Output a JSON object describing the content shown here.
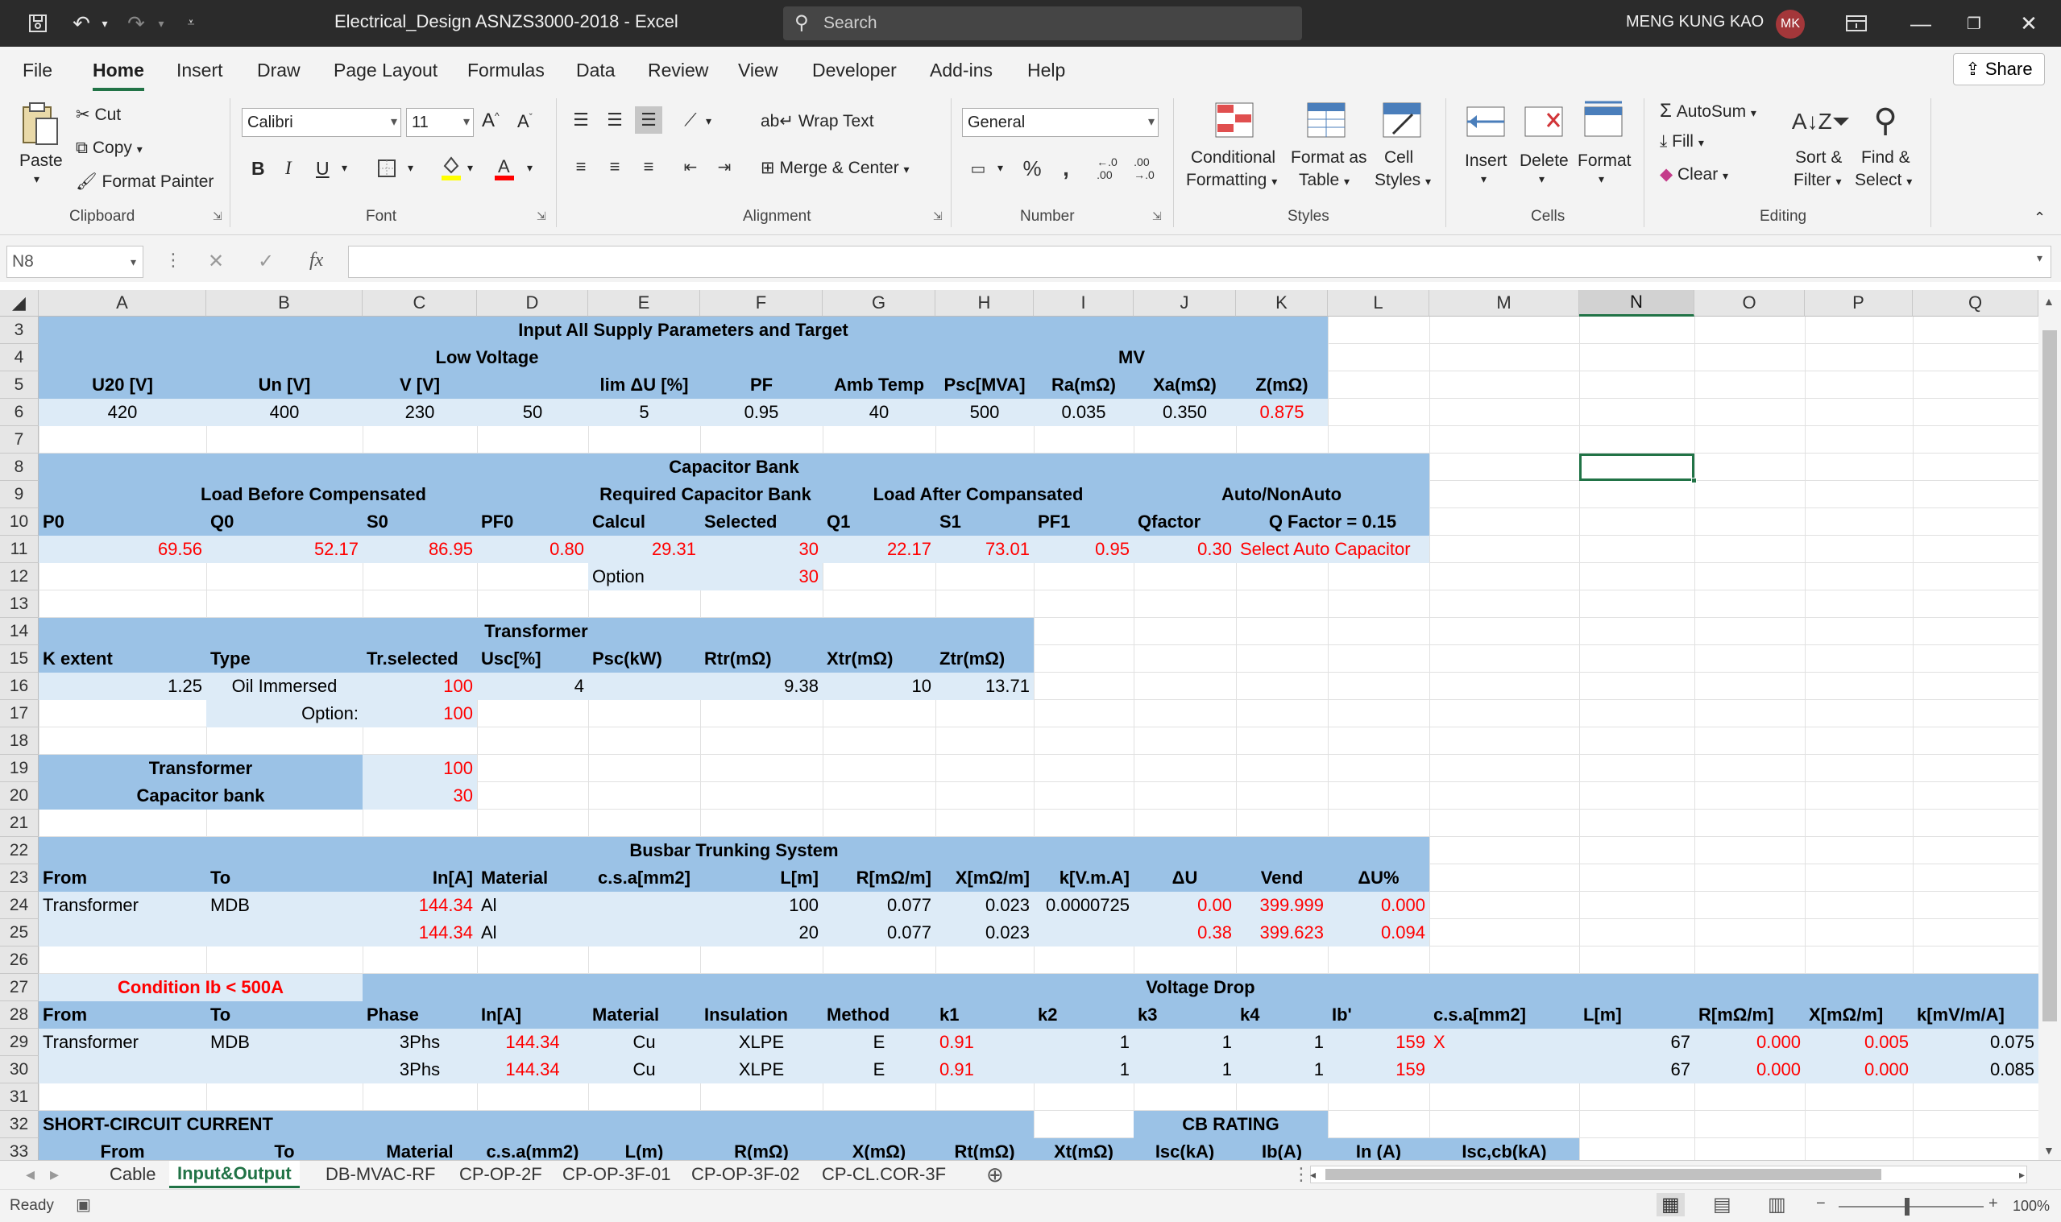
{
  "app": {
    "title": "Electrical_Design ASNZS3000-2018  -  Excel",
    "search_placeholder": "Search",
    "user_name": "MENG KUNG KAO",
    "user_initials": "MK"
  },
  "menu": [
    "File",
    "Home",
    "Insert",
    "Draw",
    "Page Layout",
    "Formulas",
    "Data",
    "Review",
    "View",
    "Developer",
    "Add-ins",
    "Help"
  ],
  "share": "Share",
  "ribbon": {
    "clipboard": {
      "paste": "Paste",
      "cut": "Cut",
      "copy": "Copy",
      "format_painter": "Format Painter",
      "group": "Clipboard"
    },
    "font": {
      "name": "Calibri",
      "size": "11",
      "bold": "B",
      "italic": "I",
      "underline": "U",
      "group": "Font"
    },
    "alignment": {
      "wrap": "Wrap Text",
      "merge": "Merge & Center",
      "group": "Alignment"
    },
    "number": {
      "format": "General",
      "group": "Number"
    },
    "styles": {
      "cond1": "Conditional",
      "cond2": "Formatting",
      "fat1": "Format as",
      "fat2": "Table",
      "cs1": "Cell",
      "cs2": "Styles",
      "group": "Styles"
    },
    "cells": {
      "insert": "Insert",
      "delete": "Delete",
      "format": "Format",
      "group": "Cells"
    },
    "editing": {
      "autosum": "AutoSum",
      "fill": "Fill",
      "clear": "Clear",
      "sort1": "Sort &",
      "sort2": "Filter",
      "find1": "Find &",
      "find2": "Select",
      "group": "Editing"
    }
  },
  "namebox": "N8",
  "fx": "fx",
  "columns": [
    "A",
    "B",
    "C",
    "D",
    "E",
    "F",
    "G",
    "H",
    "I",
    "J",
    "K",
    "L",
    "M",
    "N",
    "O",
    "P",
    "Q"
  ],
  "rows": [
    "3",
    "4",
    "5",
    "6",
    "7",
    "8",
    "9",
    "10",
    "11",
    "12",
    "13",
    "14",
    "15",
    "16",
    "17",
    "18",
    "19",
    "20",
    "21",
    "22",
    "23",
    "24",
    "25",
    "26",
    "27",
    "28",
    "29",
    "30",
    "31",
    "32",
    "33"
  ],
  "cells": {
    "r3": "Input All Supply Parameters and Target",
    "r4lv": "Low Voltage",
    "r4mv": "MV",
    "r5": [
      "U20 [V]",
      "Un [V]",
      "V [V]",
      "",
      "lim ΔU [%]",
      "PF",
      "Amb Temp",
      "Psc[MVA]",
      "Ra(mΩ)",
      "Xa(mΩ)",
      "Z(mΩ)"
    ],
    "r6": [
      "420",
      "400",
      "230",
      "50",
      "5",
      "0.95",
      "40",
      "500",
      "0.035",
      "0.350",
      "0.875"
    ],
    "r8": "Capacitor Bank",
    "r9": [
      "Load Before Compensated",
      "Required Capacitor Bank",
      "Load After Compansated",
      "Auto/NonAuto"
    ],
    "r10": [
      "P0",
      "Q0",
      "S0",
      "PF0",
      "Calcul",
      "Selected",
      "Q1",
      "S1",
      "PF1",
      "Qfactor",
      "Q Factor = 0.15"
    ],
    "r11": [
      "69.56",
      "52.17",
      "86.95",
      "0.80",
      "29.31",
      "30",
      "22.17",
      "73.01",
      "0.95",
      "0.30",
      "Select Auto Capacitor"
    ],
    "r12": [
      "Option",
      "30"
    ],
    "r14": "Transformer",
    "r15": [
      "K extent",
      "Type",
      "Tr.selected",
      "Usc[%]",
      "Psc(kW)",
      "Rtr(mΩ)",
      "Xtr(mΩ)",
      "Ztr(mΩ)"
    ],
    "r16": [
      "1.25",
      "Oil Immersed",
      "100",
      "4",
      "9.38",
      "10",
      "13.71"
    ],
    "r17": [
      "Option:",
      "100"
    ],
    "r19": [
      "Transformer",
      "100"
    ],
    "r20": [
      "Capacitor bank",
      "30"
    ],
    "r22": "Busbar Trunking System",
    "r23": [
      "From",
      "To",
      "In[A]",
      "Material",
      "c.s.a[mm2]",
      "L[m]",
      "R[mΩ/m]",
      "X[mΩ/m]",
      "k[V.m.A]",
      "ΔU",
      "Vend",
      "ΔU%"
    ],
    "r24": [
      "Transformer",
      "MDB",
      "144.34",
      "Al",
      "100",
      "0.077",
      "0.023",
      "0.0000725",
      "0.00",
      "399.999",
      "0.000"
    ],
    "r25": [
      "144.34",
      "Al",
      "20",
      "0.077",
      "0.023",
      "0.38",
      "399.623",
      "0.094"
    ],
    "r27": [
      "Condition Ib < 500A",
      "Voltage Drop"
    ],
    "r28": [
      "From",
      "To",
      "Phase",
      "In[A]",
      "Material",
      "Insulation",
      "Method",
      "k1",
      "k2",
      "k3",
      "k4",
      "Ib'",
      "c.s.a[mm2]",
      "L[m]",
      "R[mΩ/m]",
      "X[mΩ/m]",
      "k[mV/m/A]"
    ],
    "r29": [
      "Transformer",
      "MDB",
      "3Phs",
      "144.34",
      "Cu",
      "XLPE",
      "E",
      "0.91",
      "1",
      "1",
      "1",
      "159",
      "X",
      "67",
      "0.000",
      "0.005",
      "0.075"
    ],
    "r30": [
      "3Phs",
      "144.34",
      "Cu",
      "XLPE",
      "E",
      "0.91",
      "1",
      "1",
      "1",
      "159",
      "67",
      "0.000",
      "0.000",
      "0.085"
    ],
    "r32": [
      "SHORT-CIRCUIT CURRENT",
      "CB RATING"
    ],
    "r33": [
      "From",
      "To",
      "Material",
      "c.s.a(mm2)",
      "L(m)",
      "R(mΩ)",
      "X(mΩ)",
      "Rt(mΩ)",
      "Xt(mΩ)",
      "Isc(kA)",
      "Ib(A)",
      "In (A)",
      "Isc,cb(kA)"
    ]
  },
  "sheet_tabs": [
    "Cable",
    "Input&Output",
    "DB-MVAC-RF",
    "CP-OP-2F",
    "CP-OP-3F-01",
    "CP-OP-3F-02",
    "CP-CL.COR-3F"
  ],
  "status": {
    "ready": "Ready",
    "zoom": "100%"
  }
}
